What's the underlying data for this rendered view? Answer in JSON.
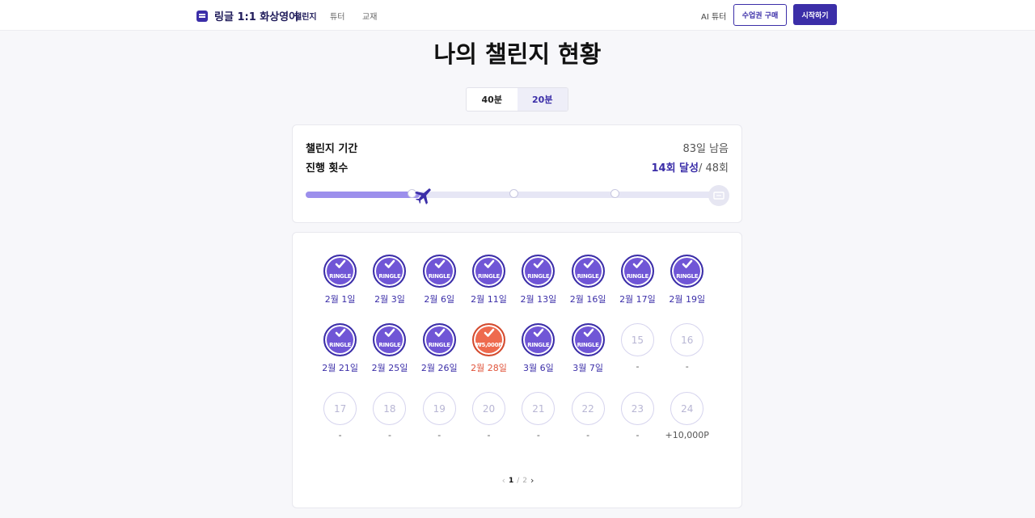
{
  "header": {
    "logo_text": "링글 1:1 화상영어",
    "nav": [
      "챌린지",
      "튜터",
      "교재"
    ],
    "ai_tutor": "AI 튜터",
    "buy_label": "수업권 구매",
    "start_label": "시작하기"
  },
  "page_title": "나의 챌린지 현황",
  "toggle": {
    "options": [
      "40분",
      "20분"
    ],
    "selected": "20분"
  },
  "summary": {
    "period_label": "챌린지 기간",
    "period_value": "83일 남음",
    "count_label": "진행 횟수",
    "achieved": "14회 달성",
    "total": "/ 48회",
    "progress_fraction": 0.28
  },
  "stamps": [
    {
      "status": "done",
      "label": "2월 1일"
    },
    {
      "status": "done",
      "label": "2월 3일"
    },
    {
      "status": "done",
      "label": "2월 6일"
    },
    {
      "status": "done",
      "label": "2월 11일"
    },
    {
      "status": "done",
      "label": "2월 13일"
    },
    {
      "status": "done",
      "label": "2월 16일"
    },
    {
      "status": "done",
      "label": "2월 17일"
    },
    {
      "status": "done",
      "label": "2월 19일"
    },
    {
      "status": "done",
      "label": "2월 21일"
    },
    {
      "status": "done",
      "label": "2월 25일"
    },
    {
      "status": "done",
      "label": "2월 26일"
    },
    {
      "status": "point",
      "label": "2월 28일",
      "stamp_text": "₩5,000P"
    },
    {
      "status": "done",
      "label": "3월 6일"
    },
    {
      "status": "done",
      "label": "3월 7일"
    },
    {
      "status": "empty",
      "number": "15",
      "label": "-"
    },
    {
      "status": "empty",
      "number": "16",
      "label": "-"
    },
    {
      "status": "empty",
      "number": "17",
      "label": "-"
    },
    {
      "status": "empty",
      "number": "18",
      "label": "-"
    },
    {
      "status": "empty",
      "number": "19",
      "label": "-"
    },
    {
      "status": "empty",
      "number": "20",
      "label": "-"
    },
    {
      "status": "empty",
      "number": "21",
      "label": "-"
    },
    {
      "status": "empty",
      "number": "22",
      "label": "-"
    },
    {
      "status": "empty",
      "number": "23",
      "label": "-"
    },
    {
      "status": "empty",
      "number": "24",
      "label": "+10,000P"
    }
  ],
  "stamp_brand": "RINGLE",
  "pager": {
    "current": "1",
    "separator": "/",
    "total": "2"
  },
  "colors": {
    "brand": "#3b2ea8",
    "stamp": "#7056d6",
    "point": "#ee6a4e",
    "progress": "#9c8fec"
  }
}
